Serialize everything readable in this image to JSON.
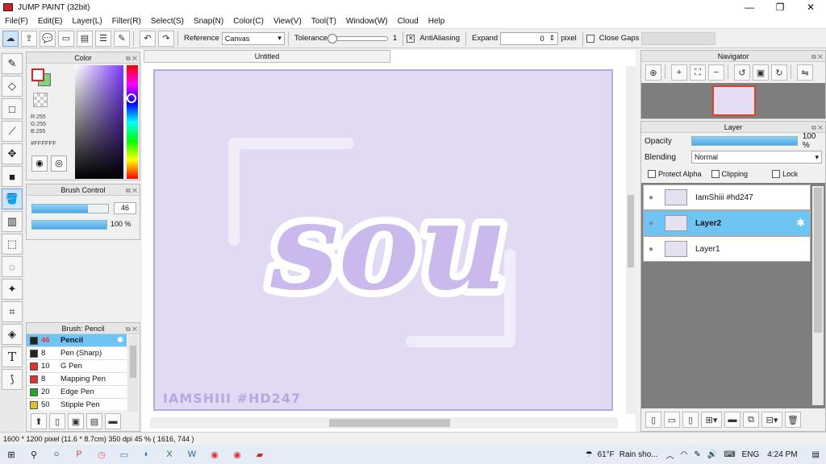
{
  "window": {
    "title": "JUMP PAINT (32bit)",
    "minimize": "—",
    "maximize": "❐",
    "close": "✕"
  },
  "menu": [
    "File(F)",
    "Edit(E)",
    "Layer(L)",
    "Filter(R)",
    "Select(S)",
    "Snap(N)",
    "Color(C)",
    "View(V)",
    "Tool(T)",
    "Window(W)",
    "Cloud",
    "Help"
  ],
  "toolbar": {
    "reference_label": "Reference",
    "reference_value": "Canvas",
    "tolerance_label": "Tolerance",
    "tolerance_value": "1",
    "antialiasing_label": "AntiAliasing",
    "expand_label": "Expand",
    "expand_value": "0",
    "expand_unit": "pixel",
    "close_gaps_label": "Close Gaps"
  },
  "color_panel": {
    "title": "Color",
    "r": "R:255",
    "g": "G:255",
    "b": "B:255",
    "hex": "#FFFFFF",
    "primary_color": "#ffffff",
    "secondary_color": "#7ed47e"
  },
  "brush_control": {
    "title": "Brush Control",
    "size_value": "46",
    "size_fraction": 0.46,
    "opacity_value": "100 %",
    "opacity_fraction": 1.0
  },
  "brush_list": {
    "title": "Brush: Pencil",
    "items": [
      {
        "size": "46",
        "name": "Pencil",
        "color": "#222222",
        "selected": true
      },
      {
        "size": "8",
        "name": "Pen (Sharp)",
        "color": "#222222",
        "selected": false
      },
      {
        "size": "10",
        "name": "G Pen",
        "color": "#e03030",
        "selected": false
      },
      {
        "size": "8",
        "name": "Mapping Pen",
        "color": "#e03030",
        "selected": false
      },
      {
        "size": "20",
        "name": "Edge Pen",
        "color": "#2aa52a",
        "selected": false
      },
      {
        "size": "50",
        "name": "Stipple Pen",
        "color": "#e6c020",
        "selected": false
      }
    ]
  },
  "document": {
    "tab_title": "Untitled",
    "canvas_bg": "#e2d9f2",
    "artwork_text": "sou",
    "watermark": "IAMSHIII #HD247"
  },
  "navigator": {
    "title": "Navigator"
  },
  "layer_panel": {
    "title": "Layer",
    "opacity_label": "Opacity",
    "opacity_value": "100 %",
    "opacity_fraction": 1.0,
    "blending_label": "Blending",
    "blending_value": "Normal",
    "protect_alpha_label": "Protect Alpha",
    "clipping_label": "Clipping",
    "lock_label": "Lock",
    "layers": [
      {
        "name": "IamShiii #hd247",
        "selected": false
      },
      {
        "name": "Layer2",
        "selected": true
      },
      {
        "name": "Layer1",
        "selected": false
      }
    ]
  },
  "status": {
    "text": "1600 * 1200 pixel  (11.6 * 8.7cm)  350 dpi  45 %  ( 1616, 744 )"
  },
  "taskbar": {
    "weather_temp": "61°F",
    "weather_text": "Rain sho...",
    "language": "ENG",
    "time": "4:24 PM"
  }
}
